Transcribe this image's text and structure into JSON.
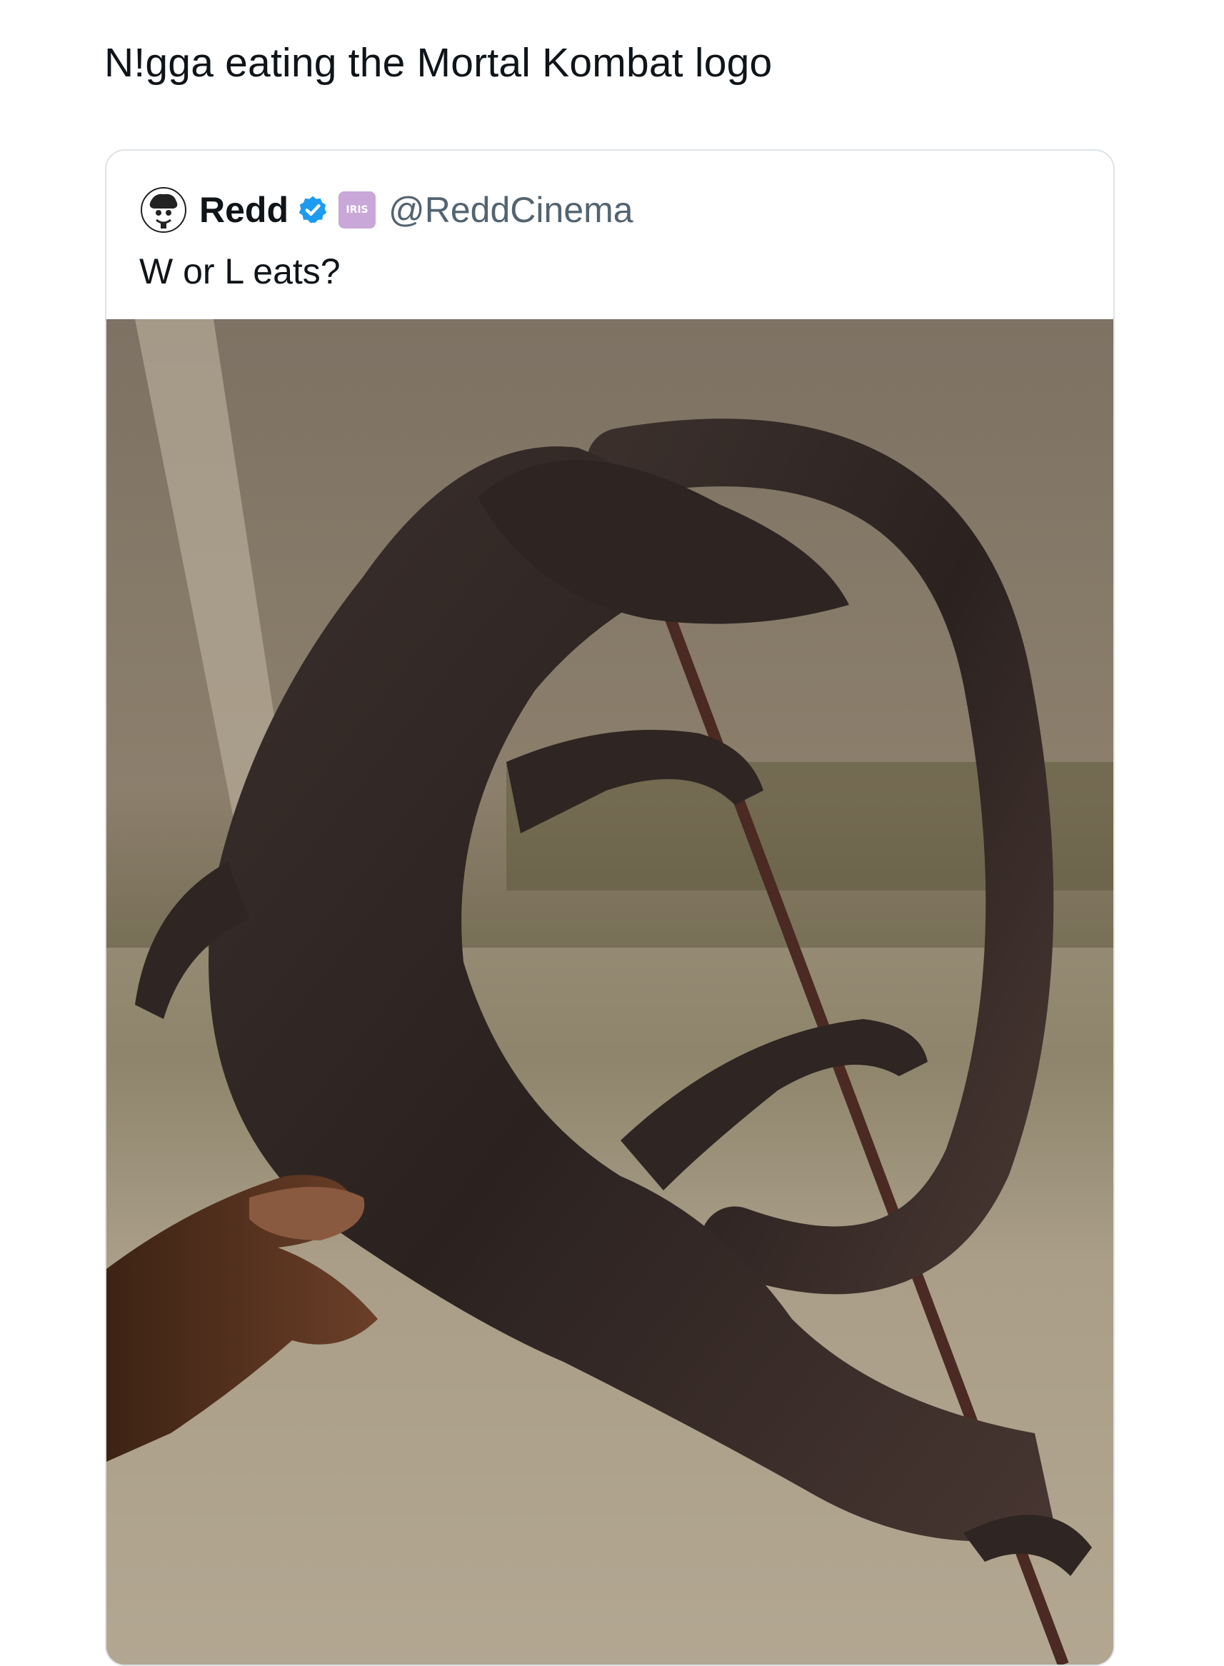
{
  "post": {
    "text": "N!gga eating the Mortal Kombat logo"
  },
  "quoted_tweet": {
    "display_name": "Redd",
    "handle": "@ReddCinema",
    "affiliate_badge": "IRIS",
    "text": "W or L eats?",
    "icons": [
      "avatar",
      "verified-badge-icon",
      "affiliate-badge-icon"
    ],
    "colors": {
      "verified": "#1d9bf0",
      "handle": "#536471",
      "affiliate": "#c9a7d8"
    }
  }
}
